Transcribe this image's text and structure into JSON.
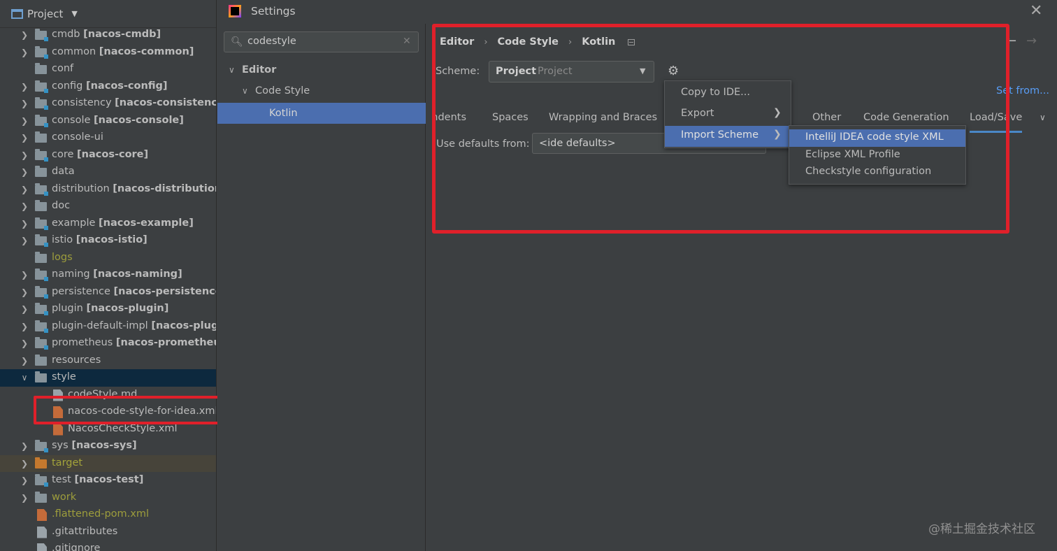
{
  "project": {
    "title": "Project",
    "rows": [
      {
        "name": "cmdb",
        "module": "[nacos-cmdb]"
      },
      {
        "name": "common",
        "module": "[nacos-common]"
      },
      {
        "name": "conf",
        "module": ""
      },
      {
        "name": "config",
        "module": "[nacos-config]"
      },
      {
        "name": "consistency",
        "module": "[nacos-consistency]"
      },
      {
        "name": "console",
        "module": "[nacos-console]"
      },
      {
        "name": "console-ui",
        "module": ""
      },
      {
        "name": "core",
        "module": "[nacos-core]"
      },
      {
        "name": "data",
        "module": ""
      },
      {
        "name": "distribution",
        "module": "[nacos-distribution]"
      },
      {
        "name": "doc",
        "module": ""
      },
      {
        "name": "example",
        "module": "[nacos-example]"
      },
      {
        "name": "istio",
        "module": "[nacos-istio]"
      },
      {
        "name": "logs",
        "module": ""
      },
      {
        "name": "naming",
        "module": "[nacos-naming]"
      },
      {
        "name": "persistence",
        "module": "[nacos-persistence]"
      },
      {
        "name": "plugin",
        "module": "[nacos-plugin]"
      },
      {
        "name": "plugin-default-impl",
        "module": "[nacos-plugi"
      },
      {
        "name": "prometheus",
        "module": "[nacos-prometheus"
      },
      {
        "name": "resources",
        "module": ""
      },
      {
        "name": "style",
        "module": ""
      },
      {
        "name": "codeStyle.md",
        "module": ""
      },
      {
        "name": "nacos-code-style-for-idea.xml",
        "module": ""
      },
      {
        "name": "NacosCheckStyle.xml",
        "module": ""
      },
      {
        "name": "sys",
        "module": "[nacos-sys]"
      },
      {
        "name": "target",
        "module": ""
      },
      {
        "name": "test",
        "module": "[nacos-test]"
      },
      {
        "name": "work",
        "module": ""
      },
      {
        "name": ".flattened-pom.xml",
        "module": ""
      },
      {
        "name": ".gitattributes",
        "module": ""
      },
      {
        "name": ".gitignore",
        "module": ""
      }
    ]
  },
  "dialog": {
    "title": "Settings",
    "search_value": "codestyle",
    "nav": [
      {
        "label": "Editor"
      },
      {
        "label": "Code Style"
      },
      {
        "label": "Kotlin"
      }
    ],
    "breadcrumb": [
      "Editor",
      "Code Style",
      "Kotlin"
    ],
    "scheme_label": "Scheme:",
    "scheme_name": "Project",
    "scheme_type": "Project",
    "set_from": "Set from...",
    "tabs": [
      {
        "label": "Indents"
      },
      {
        "label": "Spaces"
      },
      {
        "label": "Wrapping and Braces"
      },
      {
        "label": "Other"
      },
      {
        "label": "Code Generation"
      },
      {
        "label": "Load/Save"
      }
    ],
    "defaults_label": "Use defaults from:",
    "defaults_value": "<ide defaults>",
    "gear_menu": [
      {
        "label": "Copy to IDE..."
      },
      {
        "label": "Export"
      },
      {
        "label": "Import Scheme"
      }
    ],
    "import_submenu": [
      {
        "label": "IntelliJ IDEA code style XML"
      },
      {
        "label": "Eclipse XML Profile"
      },
      {
        "label": "Checkstyle configuration"
      }
    ]
  },
  "watermark": "@稀土掘金技术社区",
  "colors": {
    "highlight": "#e0202a",
    "selection": "#4b6eaf",
    "link": "#589df6"
  }
}
